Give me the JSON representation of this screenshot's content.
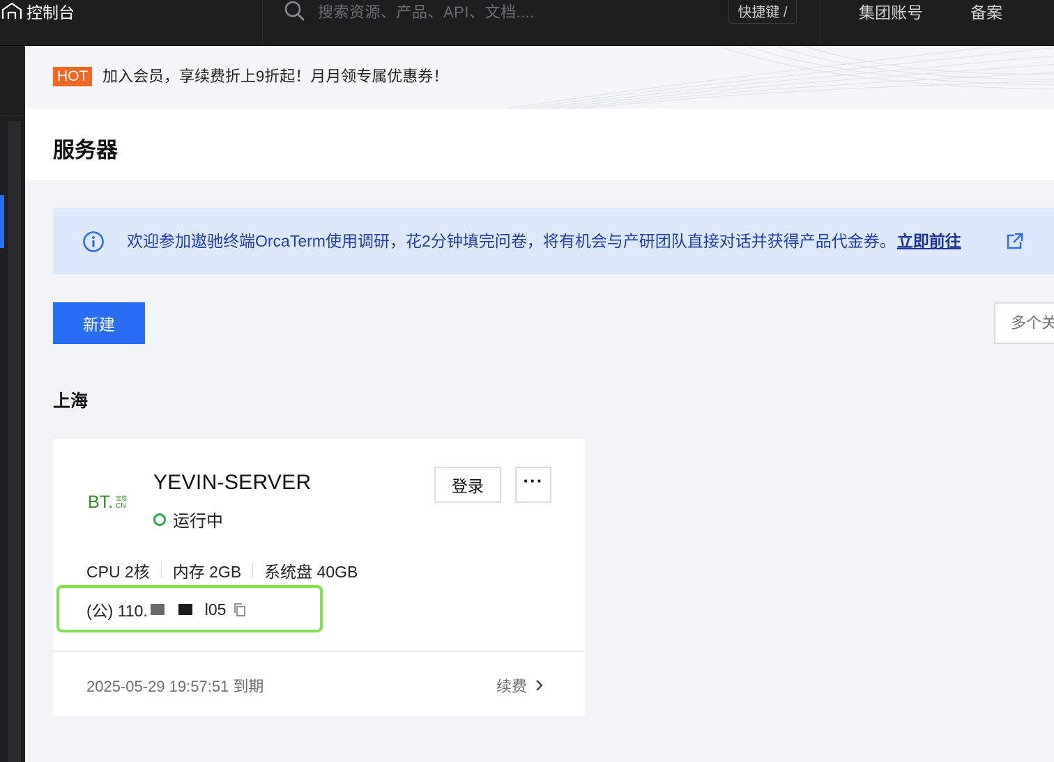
{
  "topbar": {
    "console_label": "控制台",
    "search_placeholder": "搜索资源、产品、API、文档....",
    "shortcut_label": "快捷键 /",
    "nav": [
      "集团账号",
      "备案"
    ]
  },
  "promo": {
    "badge": "HOT",
    "text": "加入会员，享续费折上9折起！月月领专属优惠券！"
  },
  "page": {
    "title": "服务器"
  },
  "notice": {
    "message": "欢迎参加遨驰终端OrcaTerm使用调研，花2分钟填完问卷，将有机会与产研团队直接对话并获得产品代金券。",
    "link_label": "立即前往"
  },
  "toolbar": {
    "new_label": "新建",
    "filter_placeholder": "多个关"
  },
  "region": {
    "name": "上海"
  },
  "server": {
    "logo_text": "BT.",
    "logo_small_top": "宝塔",
    "logo_small_bottom": "CN",
    "name": "YEVIN-SERVER",
    "status": "运行中",
    "login_label": "登录",
    "more_label": "···",
    "specs": [
      "CPU 2核",
      "内存 2GB",
      "系统盘 40GB"
    ],
    "ip_prefix": "(公) 110.",
    "ip_suffix": "l05",
    "expire": "2025-05-29 19:57:51 到期",
    "renew_label": "续费"
  },
  "colors": {
    "accent": "#2a6df5",
    "hot": "#f26522",
    "running": "#2aa84a",
    "highlight": "#7ee34a"
  }
}
